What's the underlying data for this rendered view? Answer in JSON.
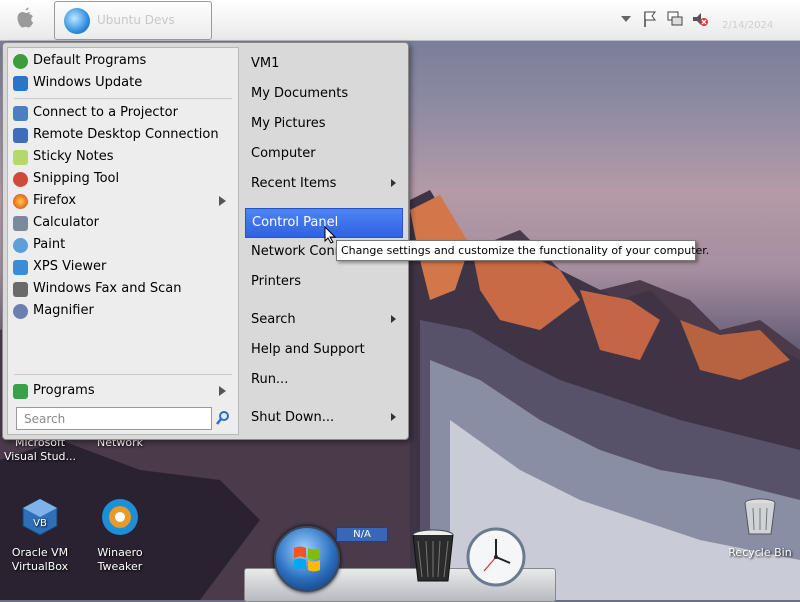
{
  "menubar": {
    "task_button_label": "Ubuntu Devs",
    "clock_text": "2/14/2024"
  },
  "start_menu": {
    "left_items": [
      {
        "label": "Default Programs",
        "icon": "default-programs-icon",
        "color": "#3b9e3b"
      },
      {
        "label": "Windows Update",
        "icon": "windows-update-icon",
        "color": "#2a74c9"
      },
      {
        "label": "Connect to a Projector",
        "icon": "projector-icon",
        "color": "#4a7fc4"
      },
      {
        "label": "Remote Desktop Connection",
        "icon": "remote-desktop-icon",
        "color": "#3c6fb8"
      },
      {
        "label": "Sticky Notes",
        "icon": "sticky-notes-icon",
        "color": "#b4d86a"
      },
      {
        "label": "Snipping Tool",
        "icon": "snipping-tool-icon",
        "color": "#d04a3a"
      },
      {
        "label": "Firefox",
        "icon": "firefox-icon",
        "color": "#e8742a"
      },
      {
        "label": "Calculator",
        "icon": "calculator-icon",
        "color": "#7a8a9c"
      },
      {
        "label": "Paint",
        "icon": "paint-icon",
        "color": "#5d9fd8"
      },
      {
        "label": "XPS Viewer",
        "icon": "xps-viewer-icon",
        "color": "#3a8cd4"
      },
      {
        "label": "Windows Fax and Scan",
        "icon": "fax-scan-icon",
        "color": "#6a6a6a"
      },
      {
        "label": "Magnifier",
        "icon": "magnifier-icon",
        "color": "#6b7fb0"
      }
    ],
    "programs_label": "Programs",
    "search_placeholder": "Search",
    "right_items": [
      {
        "label": "VM1",
        "arrow": false
      },
      {
        "label": "My Documents",
        "arrow": false
      },
      {
        "label": "My Pictures",
        "arrow": false
      },
      {
        "label": "Computer",
        "arrow": false
      },
      {
        "label": "Recent Items",
        "arrow": true
      },
      {
        "label": "Control Panel",
        "arrow": false,
        "active": true
      },
      {
        "label": "Network Conn",
        "arrow": false
      },
      {
        "label": "Printers",
        "arrow": false
      },
      {
        "label": "Search",
        "arrow": true
      },
      {
        "label": "Help and Support",
        "arrow": false
      },
      {
        "label": "Run...",
        "arrow": false
      },
      {
        "label": "Shut Down...",
        "arrow": true
      }
    ],
    "accent_color": "#2f63e0"
  },
  "tooltip": {
    "text": "Change settings and customize the functionality of your computer."
  },
  "desktop": {
    "icons": [
      {
        "label": "Microsoft Visual Stud...",
        "icon": "visual-studio-icon"
      },
      {
        "label": "Network",
        "icon": "network-icon"
      },
      {
        "label": "Oracle VM VirtualBox",
        "icon": "virtualbox-icon"
      },
      {
        "label": "Winaero Tweaker",
        "icon": "winaero-tweaker-icon"
      },
      {
        "label": "Recycle Bin",
        "icon": "recycle-bin-icon"
      }
    ]
  },
  "dock": {
    "na_label": "N/A"
  }
}
